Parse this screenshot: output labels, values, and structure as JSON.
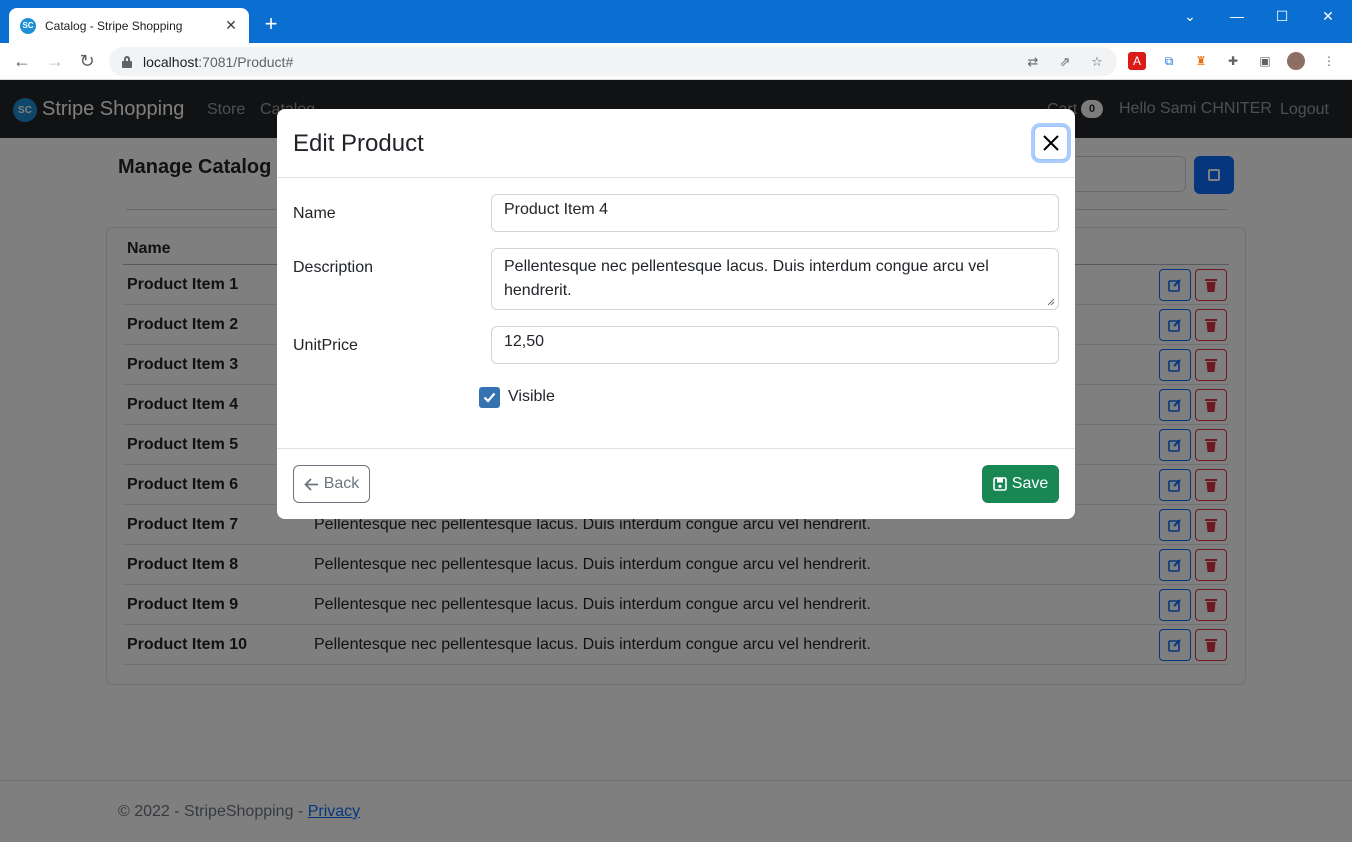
{
  "browser": {
    "tab_title": "Catalog - Stripe Shopping",
    "favicon_text": "SC",
    "url_host": "localhost",
    "url_rest": ":7081/Product#"
  },
  "app": {
    "logo_text": "SC",
    "brand": "Stripe Shopping",
    "nav": [
      "Store",
      "Catalog"
    ],
    "cart_label": "Cart",
    "cart_count": "0",
    "greeting": "Hello Sami CHNITER",
    "logout": "Logout"
  },
  "catalog": {
    "title": "Manage Catalog",
    "header_name": "Name",
    "rows": [
      {
        "name": "Product Item 1",
        "description": ""
      },
      {
        "name": "Product Item 2",
        "description": ""
      },
      {
        "name": "Product Item 3",
        "description": ""
      },
      {
        "name": "Product Item 4",
        "description": ""
      },
      {
        "name": "Product Item 5",
        "description": ""
      },
      {
        "name": "Product Item 6",
        "description": ""
      },
      {
        "name": "Product Item 7",
        "description": "Pellentesque nec pellentesque lacus. Duis interdum congue arcu vel hendrerit."
      },
      {
        "name": "Product Item 8",
        "description": "Pellentesque nec pellentesque lacus. Duis interdum congue arcu vel hendrerit."
      },
      {
        "name": "Product Item 9",
        "description": "Pellentesque nec pellentesque lacus. Duis interdum congue arcu vel hendrerit."
      },
      {
        "name": "Product Item 10",
        "description": "Pellentesque nec pellentesque lacus. Duis interdum congue arcu vel hendrerit."
      }
    ]
  },
  "footer": {
    "text": "© 2022 - StripeShopping - ",
    "privacy": "Privacy"
  },
  "modal": {
    "title": "Edit Product",
    "name_label": "Name",
    "name_value": "Product Item 4",
    "description_label": "Description",
    "description_value": "Pellentesque nec pellentesque lacus. Duis interdum congue arcu vel hendrerit.",
    "price_label": "UnitPrice",
    "price_value": "12,50",
    "visible_label": "Visible",
    "visible_checked": true,
    "back_label": "Back",
    "save_label": "Save"
  },
  "colors": {
    "titlebar": "#0b6fd1",
    "navbar": "#212529",
    "primary": "#0d6efd",
    "danger": "#dc3545",
    "success": "#198754"
  }
}
